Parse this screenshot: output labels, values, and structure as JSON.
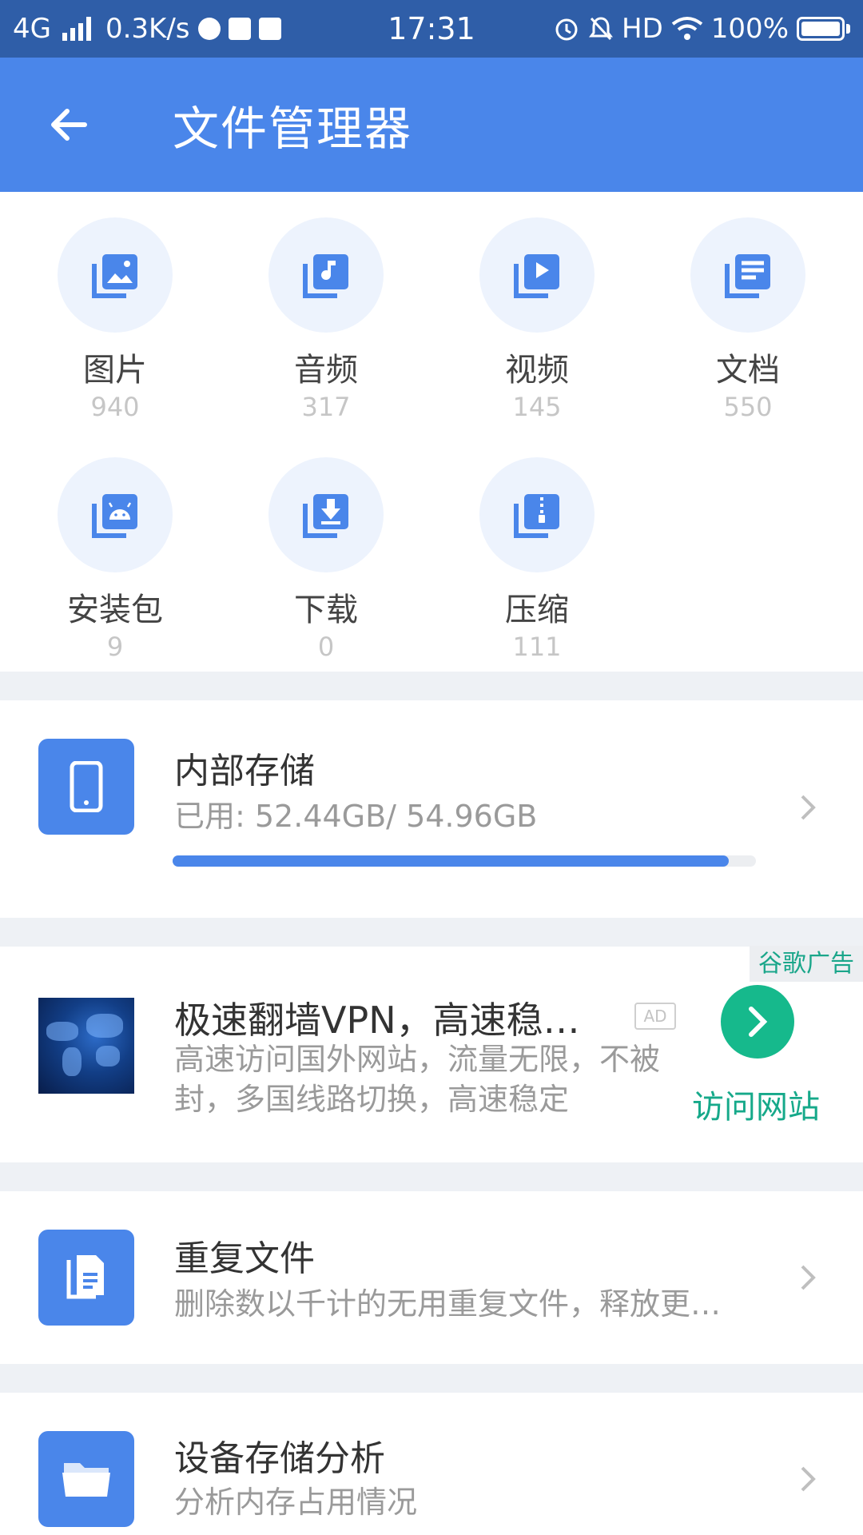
{
  "status_bar": {
    "network": "4G",
    "speed": "0.3K/s",
    "time": "17:31",
    "hd": "HD",
    "battery": "100%"
  },
  "app_bar": {
    "title": "文件管理器",
    "back_icon": "arrow-left-icon"
  },
  "categories": [
    {
      "label": "图片",
      "count": "940",
      "icon": "image-icon"
    },
    {
      "label": "音频",
      "count": "317",
      "icon": "music-icon"
    },
    {
      "label": "视频",
      "count": "145",
      "icon": "video-icon"
    },
    {
      "label": "文档",
      "count": "550",
      "icon": "document-icon"
    },
    {
      "label": "安装包",
      "count": "9",
      "icon": "android-icon"
    },
    {
      "label": "下载",
      "count": "0",
      "icon": "download-icon"
    },
    {
      "label": "压缩",
      "count": "111",
      "icon": "zip-icon"
    }
  ],
  "storage": {
    "title": "内部存储",
    "usage": "已用: 52.44GB/ 54.96GB",
    "used_fraction": 0.954,
    "icon": "phone-icon"
  },
  "ad": {
    "label": "谷歌广告",
    "title": "极速翻墙VPN，高速稳…",
    "badge": "AD",
    "description": "高速访问国外网站，流量无限，不被封，多国线路切换，高速稳定",
    "cta": "访问网站"
  },
  "duplicates": {
    "title": "重复文件",
    "subtitle": "删除数以千计的无用重复文件，释放更…",
    "icon": "duplicate-file-icon"
  },
  "analysis": {
    "title": "设备存储分析",
    "subtitle": "分析内存占用情况",
    "icon": "folder-icon"
  },
  "colors": {
    "status_bar": "#2f5ea8",
    "primary": "#4a86ea",
    "icon_bg": "#edf3fd",
    "ad_green": "#16b98c",
    "separator": "#eef1f5"
  }
}
